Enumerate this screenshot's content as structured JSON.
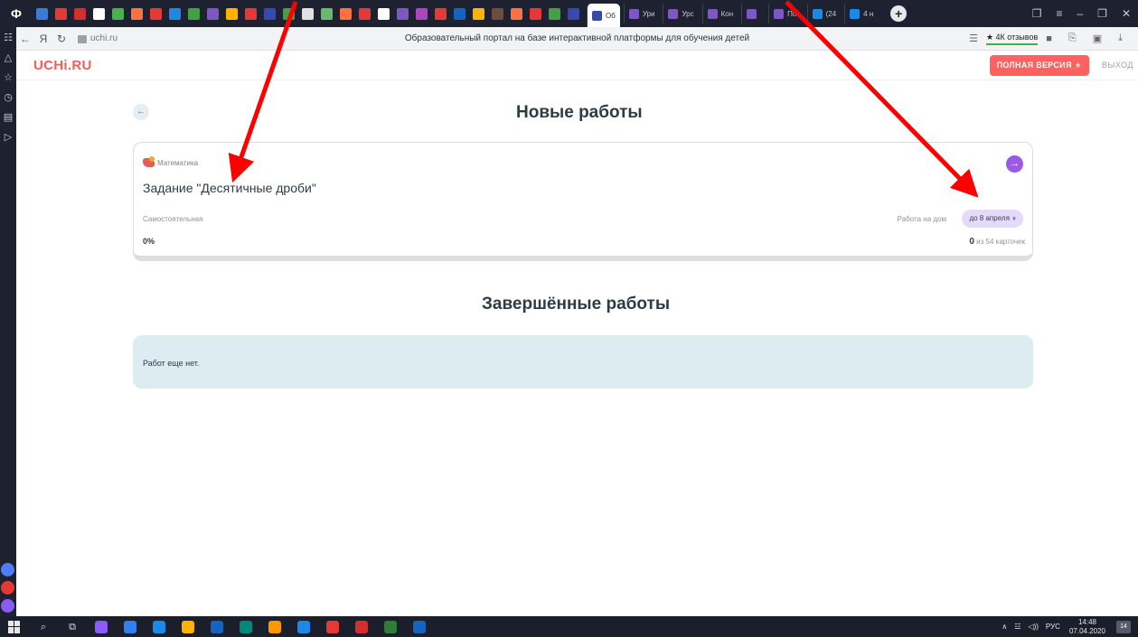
{
  "browser": {
    "brand_glyph": "Ф",
    "pinned_colors": [
      "#3a7bd5",
      "#e53935",
      "#d32f2f",
      "#ffffff",
      "#4caf50",
      "#ff7043",
      "#e53935",
      "#1e88e5",
      "#43a047",
      "#7e57c2",
      "#ffb300",
      "#e53935",
      "#3949ab",
      "#43a047",
      "#e0e0e0",
      "#66bb6a",
      "#ff7043",
      "#e53935",
      "#ffffff",
      "#7e57c2",
      "#ab47bc",
      "#e53935",
      "#1565c0",
      "#ffb300",
      "#6d4c41",
      "#ff7043",
      "#e53935",
      "#43a047",
      "#3949ab"
    ],
    "tabs": [
      {
        "label": "Об",
        "color": "#3949ab",
        "active": true
      },
      {
        "label": "Ури",
        "color": "#7e57c2"
      },
      {
        "label": "Урс",
        "color": "#7e57c2"
      },
      {
        "label": "Кон",
        "color": "#7e57c2"
      },
      {
        "label": "",
        "color": "#7e57c2"
      },
      {
        "label": "По.",
        "color": "#7e57c2"
      },
      {
        "label": "(24",
        "color": "#1e88e5"
      },
      {
        "label": "4 н",
        "color": "#1e88e5"
      }
    ],
    "new_tab": "+",
    "window_controls": [
      "❐",
      "≡",
      "–",
      "❐",
      "✕"
    ],
    "address": {
      "back": "←",
      "yandex": "Я",
      "reload": "↻",
      "url": "uchi.ru",
      "title": "Образовательный портал на базе интерактивной платформы для обучения детей",
      "reviews": "★ 4К отзывов",
      "right_icons": [
        "☰",
        "■",
        "⎘",
        "▣",
        "⤓"
      ]
    },
    "sidebar_icons": [
      "☷",
      "△",
      "☆",
      "◷",
      "▤",
      "▷"
    ],
    "sidebar_bubbles": [
      "#4f7df5",
      "#e53935",
      "#8a5cf5"
    ]
  },
  "site": {
    "logo": "UCHi.RU",
    "full_version": "ПОЛНАЯ ВЕРСИЯ",
    "full_version_star": "★",
    "logout": "ВЫХОД"
  },
  "main": {
    "back_glyph": "←",
    "new_works_title": "Новые работы",
    "task": {
      "subject": "Математика",
      "title": "Задание \"Десятичные дроби\"",
      "type": "Самостоятельная",
      "home_label": "Работа на дом",
      "deadline": "до 8 апреля",
      "deadline_icon": "🔔",
      "progress": "0%",
      "cards_done": "0",
      "cards_total": "из 54 карточек",
      "go_glyph": "→"
    },
    "completed_title": "Завершённые работы",
    "empty_text": "Работ еще нет."
  },
  "taskbar": {
    "search_glyph": "⌕",
    "taskview_glyph": "⧉",
    "apps": [
      "#8a5cf5",
      "#2f80ed",
      "#1e88e5",
      "#ffb300",
      "#1565c0",
      "#00897b",
      "#ff9800",
      "#1e88e5",
      "#e53935",
      "#d32f2f",
      "#2e7d32",
      "#1565c0"
    ],
    "tray": [
      "∧",
      "☳",
      "◁))",
      "РУС"
    ],
    "time": "14:48",
    "date": "07.04.2020",
    "notifications": "14"
  },
  "colors": {
    "brand": "#ff5a55",
    "accent_purple": "#9b59e6",
    "arrow": "#ff0000"
  }
}
